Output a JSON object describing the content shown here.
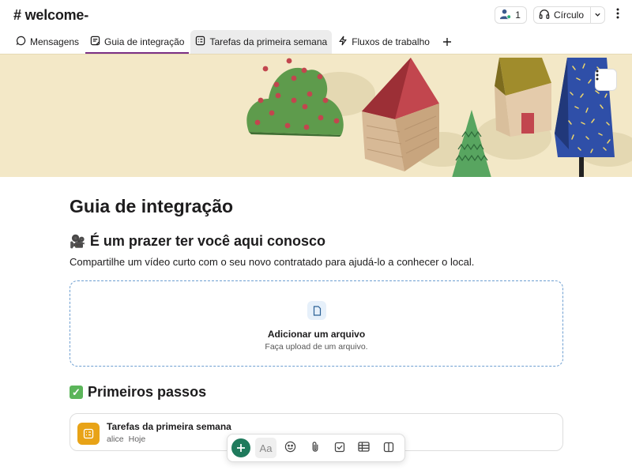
{
  "header": {
    "channel_title": "# welcome-",
    "member_count": "1",
    "huddle_label": "Círculo"
  },
  "tabs": [
    {
      "label": "Mensagens",
      "icon": "message-icon"
    },
    {
      "label": "Guia de integração",
      "icon": "canvas-icon",
      "active": true
    },
    {
      "label": "Tarefas da primeira semana",
      "icon": "list-icon"
    },
    {
      "label": "Fluxos de trabalho",
      "icon": "lightning-icon"
    }
  ],
  "doc": {
    "title": "Guia de integração",
    "section1_emoji": "🎥",
    "section1_heading": "É um prazer ter você aqui conosco",
    "section1_text": "Compartilhe um vídeo curto com o seu novo contratado para ajudá-lo a conhecer o local.",
    "upload_title": "Adicionar um arquivo",
    "upload_subtitle": "Faça upload de um arquivo.",
    "section2_heading": "Primeiros passos",
    "card_title": "Tarefas da primeira semana",
    "card_author": "alice",
    "card_date": "Hoje"
  },
  "toolbar": {
    "aa_label": "Aa"
  },
  "colors": {
    "active_tab_underline": "#7c3085",
    "banner_bg": "#f3e8c7",
    "compose_button": "#1f7a5c",
    "card_icon_bg": "#e8a317",
    "upload_border": "#6e9fd1"
  }
}
